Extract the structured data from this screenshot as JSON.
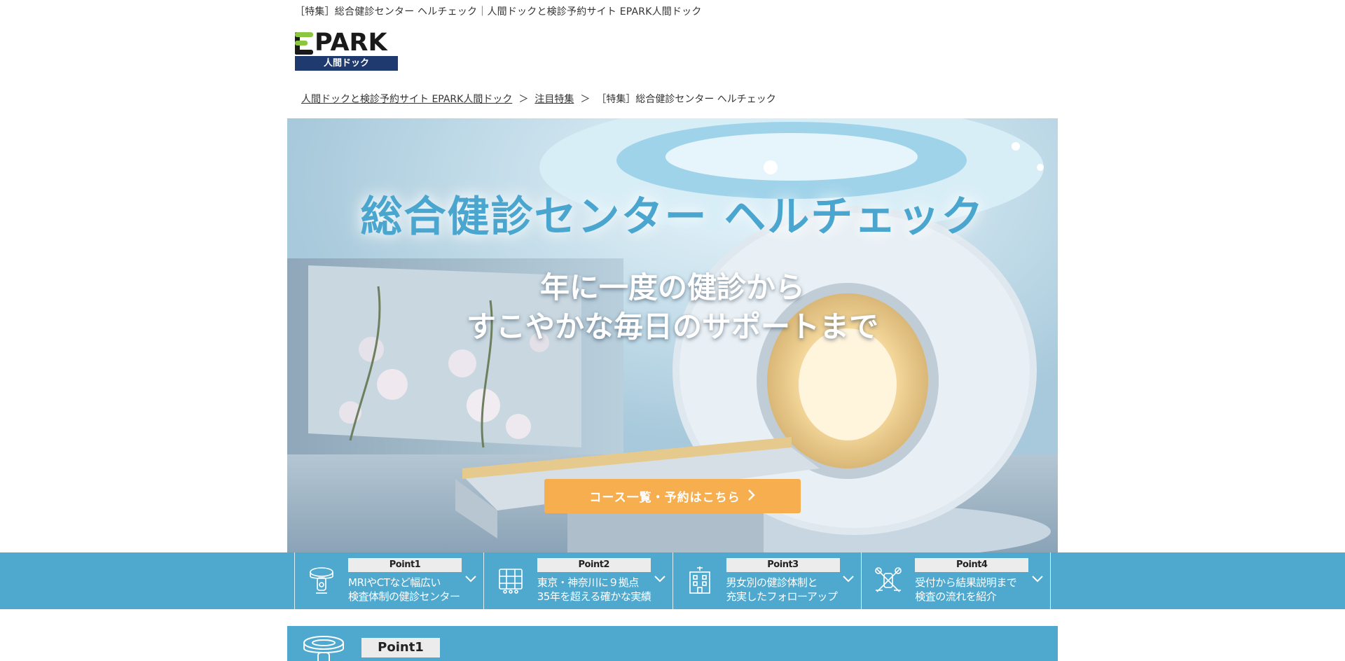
{
  "header": {
    "tagline": "［特集］総合健診センター ヘルチェック｜人間ドックと検診予約サイト EPARK人間ドック",
    "logo": {
      "brand": "PARK",
      "sub": "人間ドック"
    }
  },
  "breadcrumb": {
    "items": [
      {
        "label": "人間ドックと検診予約サイト EPARK人間ドック",
        "link": true
      },
      {
        "label": "注目特集",
        "link": true
      },
      {
        "label": "［特集］総合健診センター ヘルチェック",
        "link": false
      }
    ],
    "separator": "＞"
  },
  "hero": {
    "title": "総合健診センター ヘルチェック",
    "lead_line1": "年に一度の健診から",
    "lead_line2": "すこやかな毎日のサポートまで",
    "cta_label": "コース一覧・予約はこちら",
    "cta_color": "#f6ae4e"
  },
  "points": [
    {
      "badge": "Point1",
      "line1": "MRIやCTなど幅広い",
      "line2": "検査体制の健診センター",
      "icon": "mri-scanner-icon"
    },
    {
      "badge": "Point2",
      "line1": "東京・神奈川に９拠点",
      "line2": "35年を超える確かな実績",
      "icon": "map-pins-icon"
    },
    {
      "badge": "Point3",
      "line1": "男女別の健診体制と",
      "line2": "充実したフォローアップ",
      "icon": "building-icon"
    },
    {
      "badge": "Point4",
      "line1": "受付から結果説明まで",
      "line2": "検査の流れを紹介",
      "icon": "crossed-tools-icon"
    }
  ],
  "section": {
    "badge": "Point1",
    "icon": "mri-scanner-icon"
  },
  "colors": {
    "accent_blue": "#4fa9cf",
    "brand_navy": "#1e3a6e",
    "brand_green": "#8cc63f"
  }
}
